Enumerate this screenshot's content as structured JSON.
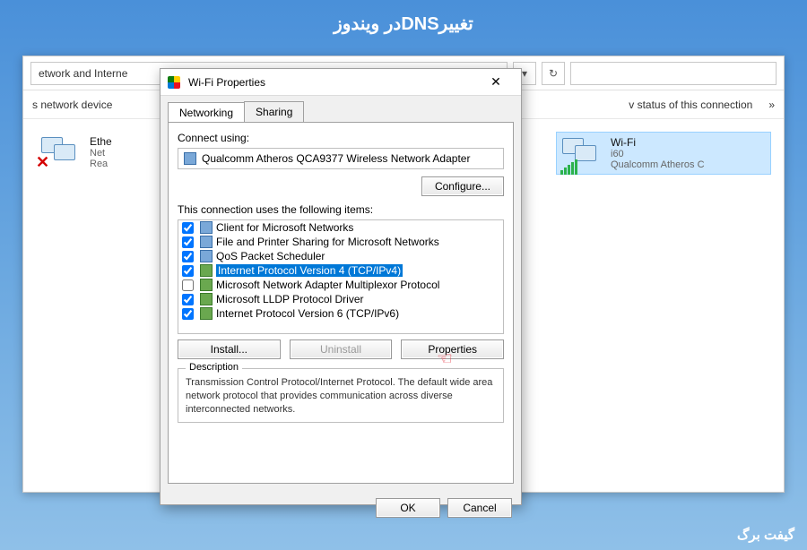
{
  "page": {
    "title": "تغییرDNSدر ویندوز",
    "footer": "گیفت برگ"
  },
  "explorer": {
    "address": "etwork and Interne",
    "refresh": "↻",
    "search_placeholder": "",
    "toolbar": {
      "left": "s network device",
      "status": "v status of this connection",
      "more": "»"
    },
    "adapters": [
      {
        "name": "Ethe",
        "line2": "Net",
        "line3": "Rea"
      },
      {
        "name": "Wi-Fi",
        "line2": "i60",
        "line3": "Qualcomm Atheros C"
      }
    ]
  },
  "dialog": {
    "title": "Wi-Fi Properties",
    "tabs": {
      "networking": "Networking",
      "sharing": "Sharing"
    },
    "connect_using_label": "Connect using:",
    "adapter": "Qualcomm Atheros QCA9377 Wireless Network Adapter",
    "configure_btn": "Configure...",
    "items_label": "This connection uses the following items:",
    "items": [
      {
        "checked": true,
        "label": "Client for Microsoft Networks"
      },
      {
        "checked": true,
        "label": "File and Printer Sharing for Microsoft Networks"
      },
      {
        "checked": true,
        "label": "QoS Packet Scheduler"
      },
      {
        "checked": true,
        "label": "Internet Protocol Version 4 (TCP/IPv4)",
        "selected": true
      },
      {
        "checked": false,
        "label": "Microsoft Network Adapter Multiplexor Protocol"
      },
      {
        "checked": true,
        "label": "Microsoft LLDP Protocol Driver"
      },
      {
        "checked": true,
        "label": "Internet Protocol Version 6 (TCP/IPv6)"
      }
    ],
    "install_btn": "Install...",
    "uninstall_btn": "Uninstall",
    "properties_btn": "Properties",
    "description_legend": "Description",
    "description": "Transmission Control Protocol/Internet Protocol. The default wide area network protocol that provides communication across diverse interconnected networks.",
    "ok_btn": "OK",
    "cancel_btn": "Cancel"
  }
}
